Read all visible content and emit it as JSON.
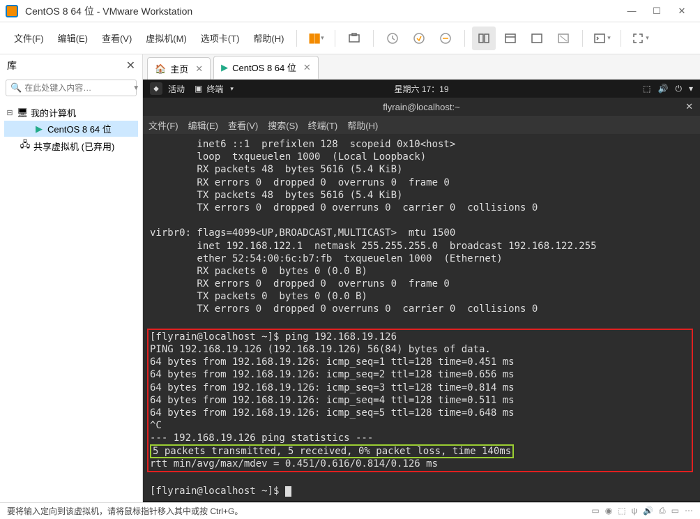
{
  "window": {
    "title": "CentOS 8 64 位 - VMware Workstation",
    "min": "—",
    "max": "☐",
    "close": "✕"
  },
  "menu": {
    "file": "文件(F)",
    "edit": "编辑(E)",
    "view": "查看(V)",
    "vm": "虚拟机(M)",
    "tabs": "选项卡(T)",
    "help": "帮助(H)"
  },
  "sidebar": {
    "title": "库",
    "search_placeholder": "在此处键入内容…",
    "nodes": {
      "root": "我的计算机",
      "vm": "CentOS 8 64 位",
      "shared": "共享虚拟机 (已弃用)"
    }
  },
  "tabs": {
    "home": "主页",
    "vm": "CentOS 8 64 位"
  },
  "gnome": {
    "activities": "活动",
    "app": "终端",
    "clock": "星期六 17：19"
  },
  "terminal": {
    "title": "flyrain@localhost:~",
    "menu": {
      "file": "文件(F)",
      "edit": "编辑(E)",
      "view": "查看(V)",
      "search": "搜索(S)",
      "terminal": "终端(T)",
      "help": "帮助(H)"
    },
    "pre_lines": "        inet6 ::1  prefixlen 128  scopeid 0x10<host>\n        loop  txqueuelen 1000  (Local Loopback)\n        RX packets 48  bytes 5616 (5.4 KiB)\n        RX errors 0  dropped 0  overruns 0  frame 0\n        TX packets 48  bytes 5616 (5.4 KiB)\n        TX errors 0  dropped 0 overruns 0  carrier 0  collisions 0\n\nvirbr0: flags=4099<UP,BROADCAST,MULTICAST>  mtu 1500\n        inet 192.168.122.1  netmask 255.255.255.0  broadcast 192.168.122.255\n        ether 52:54:00:6c:b7:fb  txqueuelen 1000  (Ethernet)\n        RX packets 0  bytes 0 (0.0 B)\n        RX errors 0  dropped 0  overruns 0  frame 0\n        TX packets 0  bytes 0 (0.0 B)\n        TX errors 0  dropped 0 overruns 0  carrier 0  collisions 0\n",
    "ping_cmd_prompt": "[flyrain@localhost ~]$ ",
    "ping_cmd": "ping 192.168.19.126",
    "ping_body": "PING 192.168.19.126 (192.168.19.126) 56(84) bytes of data.\n64 bytes from 192.168.19.126: icmp_seq=1 ttl=128 time=0.451 ms\n64 bytes from 192.168.19.126: icmp_seq=2 ttl=128 time=0.656 ms\n64 bytes from 192.168.19.126: icmp_seq=3 ttl=128 time=0.814 ms\n64 bytes from 192.168.19.126: icmp_seq=4 ttl=128 time=0.511 ms\n64 bytes from 192.168.19.126: icmp_seq=5 ttl=128 time=0.648 ms\n^C\n--- 192.168.19.126 ping statistics ---",
    "ping_stats": "5 packets transmitted, 5 received, 0% packet loss, time 140ms",
    "ping_rtt": "rtt min/avg/max/mdev = 0.451/0.616/0.814/0.126 ms",
    "prompt2": "[flyrain@localhost ~]$ "
  },
  "status": {
    "text": "要将输入定向到该虚拟机，请将鼠标指针移入其中或按 Ctrl+G。"
  }
}
